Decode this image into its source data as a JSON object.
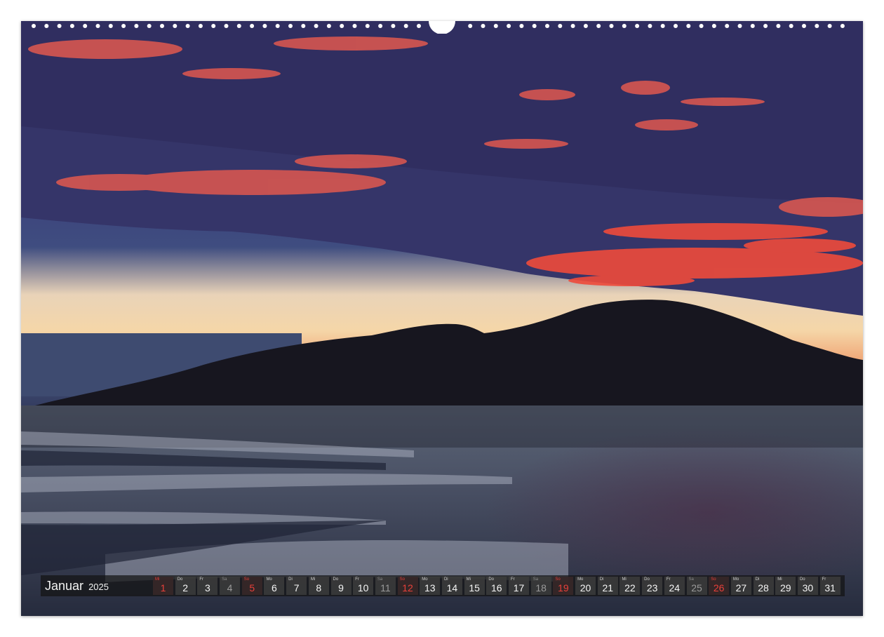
{
  "calendar": {
    "month": "Januar",
    "year": "2025",
    "days": [
      {
        "wd": "Mi",
        "d": "1",
        "type": "sun"
      },
      {
        "wd": "Do",
        "d": "2",
        "type": "wk"
      },
      {
        "wd": "Fr",
        "d": "3",
        "type": "wk"
      },
      {
        "wd": "Sa",
        "d": "4",
        "type": "sat"
      },
      {
        "wd": "So",
        "d": "5",
        "type": "sun"
      },
      {
        "wd": "Mo",
        "d": "6",
        "type": "wk"
      },
      {
        "wd": "Di",
        "d": "7",
        "type": "wk"
      },
      {
        "wd": "Mi",
        "d": "8",
        "type": "wk"
      },
      {
        "wd": "Do",
        "d": "9",
        "type": "wk"
      },
      {
        "wd": "Fr",
        "d": "10",
        "type": "wk"
      },
      {
        "wd": "Sa",
        "d": "11",
        "type": "sat"
      },
      {
        "wd": "So",
        "d": "12",
        "type": "sun"
      },
      {
        "wd": "Mo",
        "d": "13",
        "type": "wk"
      },
      {
        "wd": "Di",
        "d": "14",
        "type": "wk"
      },
      {
        "wd": "Mi",
        "d": "15",
        "type": "wk"
      },
      {
        "wd": "Do",
        "d": "16",
        "type": "wk"
      },
      {
        "wd": "Fr",
        "d": "17",
        "type": "wk"
      },
      {
        "wd": "Sa",
        "d": "18",
        "type": "sat"
      },
      {
        "wd": "So",
        "d": "19",
        "type": "sun"
      },
      {
        "wd": "Mo",
        "d": "20",
        "type": "wk"
      },
      {
        "wd": "Di",
        "d": "21",
        "type": "wk"
      },
      {
        "wd": "Mi",
        "d": "22",
        "type": "wk"
      },
      {
        "wd": "Do",
        "d": "23",
        "type": "wk"
      },
      {
        "wd": "Fr",
        "d": "24",
        "type": "wk"
      },
      {
        "wd": "Sa",
        "d": "25",
        "type": "sat"
      },
      {
        "wd": "So",
        "d": "26",
        "type": "sun"
      },
      {
        "wd": "Mo",
        "d": "27",
        "type": "wk"
      },
      {
        "wd": "Di",
        "d": "28",
        "type": "wk"
      },
      {
        "wd": "Mi",
        "d": "29",
        "type": "wk"
      },
      {
        "wd": "Do",
        "d": "30",
        "type": "wk"
      },
      {
        "wd": "Fr",
        "d": "31",
        "type": "wk"
      }
    ]
  },
  "colors": {
    "sunday": "#e8403a",
    "saturday": "#9a9a9a",
    "weekday": "#f5f5f5"
  }
}
